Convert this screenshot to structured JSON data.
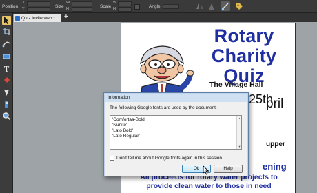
{
  "toolbar": {
    "position_label": "Position",
    "size_label": "Size",
    "scale_label": "Scale",
    "angle_label": "Angle",
    "axis_x": "X",
    "axis_y": "Y",
    "axis_w": "W",
    "axis_h": "H"
  },
  "tabs": {
    "document_tab": "Quiz Invite.web *",
    "close_symbol": "×",
    "add_symbol": "+"
  },
  "poster": {
    "title_line1": "Rotary",
    "title_line2": "Charity Quiz",
    "venue": "The Village Hall",
    "date_left": "Friday 25th",
    "date_right": "pril",
    "supper": "upper",
    "opening": "ening",
    "cause_line1": "All proceeds for rotary water projects to",
    "cause_line2": "provide clean water to those in need"
  },
  "dialog": {
    "title": "Information",
    "message": "The following Google fonts are used by the document.",
    "fonts": [
      "'Comfortaa-Bold'",
      "'Nunito'",
      "'Lato Bold'",
      "'Lato Regular'"
    ],
    "dont_tell_label": "Don't tell me about Google fonts again in this session",
    "dont_tell_checked": false,
    "ok_label": "Ok",
    "help_label": "Help"
  },
  "colors": {
    "accent_blue": "#1f2ea0",
    "active_tool": "#e7c46a",
    "dialog_title_bar": "#cfe0f3"
  },
  "icons": {
    "tools": [
      "select-arrow-icon",
      "transform-icon",
      "shape-icon",
      "rectangle-icon",
      "text-icon",
      "fill-icon",
      "transparency-icon",
      "eyedropper-icon",
      "zoom-icon"
    ],
    "toolbar": [
      "flip-horizontal-icon",
      "flip-vertical-icon",
      "node-tool-icon",
      "tag-icon"
    ]
  }
}
